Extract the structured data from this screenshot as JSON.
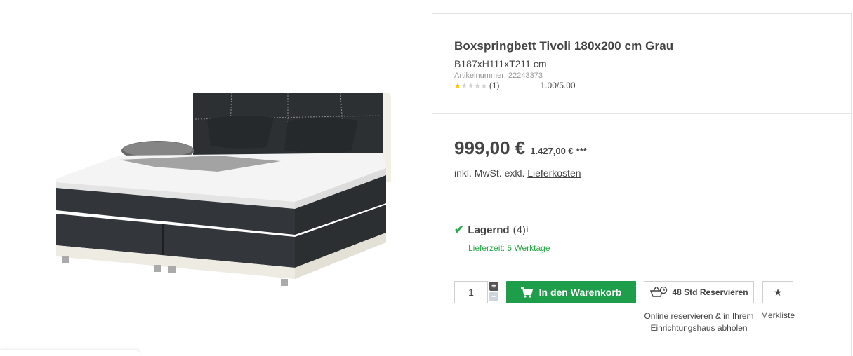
{
  "product": {
    "title": "Boxspringbett Tivoli 180x200 cm Grau",
    "dimensions": "B187xH111xT211 cm",
    "sku_label": "Artikelnummer:",
    "sku_value": "22243373",
    "rating": {
      "stars_filled": 1,
      "stars_total": 5,
      "count": "(1)",
      "score": "1.00",
      "score_max": "/5.00"
    }
  },
  "price": {
    "current": "999,00 €",
    "old": "1.427,00 €",
    "old_mark": "***",
    "tax_text": "inkl. MwSt. exkl.",
    "shipping_link": "Lieferkosten"
  },
  "stock": {
    "label": "Lagernd",
    "count": "(4)",
    "info": "i",
    "delivery": "Lieferzeit: 5 Werktage"
  },
  "actions": {
    "quantity": "1",
    "cart_label": "In den Warenkorb",
    "reserve_label": "48 Std Reservieren",
    "reserve_note": "Online reservieren & in Ihrem Einrichtungshaus abholen",
    "wishlist_label": "Merkliste"
  },
  "colors": {
    "green": "#1e9d4a",
    "star": "#f5c200",
    "text": "#444444"
  }
}
